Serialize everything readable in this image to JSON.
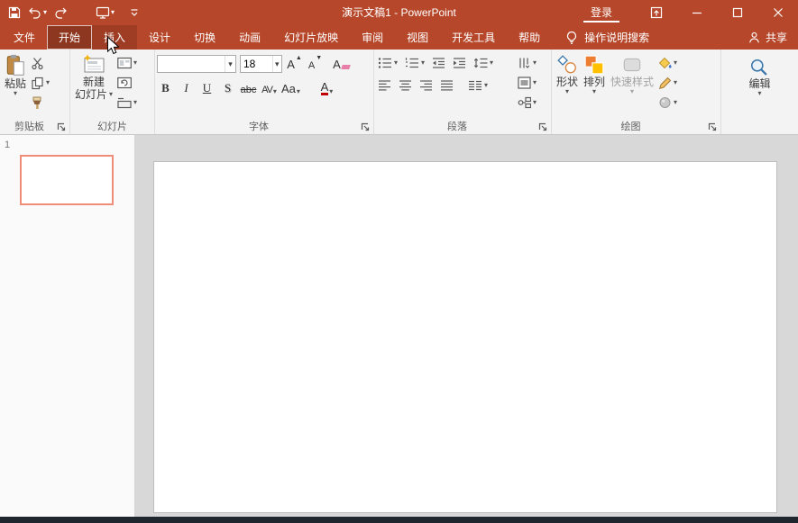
{
  "window": {
    "title": "演示文稿1 - PowerPoint",
    "signin_label": "登录"
  },
  "tabs": [
    {
      "label": "文件",
      "state": "file"
    },
    {
      "label": "开始",
      "state": "active"
    },
    {
      "label": "插入",
      "state": "hover"
    },
    {
      "label": "设计",
      "state": "normal"
    },
    {
      "label": "切换",
      "state": "normal"
    },
    {
      "label": "动画",
      "state": "normal"
    },
    {
      "label": "幻灯片放映",
      "state": "normal"
    },
    {
      "label": "审阅",
      "state": "normal"
    },
    {
      "label": "视图",
      "state": "normal"
    },
    {
      "label": "开发工具",
      "state": "normal"
    },
    {
      "label": "帮助",
      "state": "normal"
    }
  ],
  "tell_me_label": "操作说明搜索",
  "share_label": "共享",
  "ribbon": {
    "clipboard": {
      "group_label": "剪贴板",
      "paste_label": "粘贴"
    },
    "slides": {
      "group_label": "幻灯片",
      "new_slide_line1": "新建",
      "new_slide_line2": "幻灯片"
    },
    "font": {
      "group_label": "字体",
      "font_name_value": "",
      "font_size_value": "18",
      "increase_label": "A",
      "decrease_label": "A",
      "clear_label": "A",
      "bold_label": "B",
      "italic_label": "I",
      "underline_label": "U",
      "shadow_label": "S",
      "strikethrough_label": "abc",
      "char_spacing_label": "AV",
      "change_case_label": "Aa",
      "font_color_label": "A"
    },
    "paragraph": {
      "group_label": "段落"
    },
    "drawing": {
      "group_label": "绘图",
      "shapes_label": "形状",
      "arrange_label": "排列",
      "quick_styles_label": "快速样式"
    },
    "editing": {
      "button_label": "编辑"
    }
  },
  "slides_panel": {
    "slide_number": "1"
  },
  "colors": {
    "titlebar": "#B7472A",
    "ribbon_bg": "#F3F3F3",
    "canvas_bg": "#D8D8D8",
    "selected_slide_border": "#EE8E79",
    "bottom_bar": "#20262E",
    "font_color_indicator": "#C00000"
  }
}
